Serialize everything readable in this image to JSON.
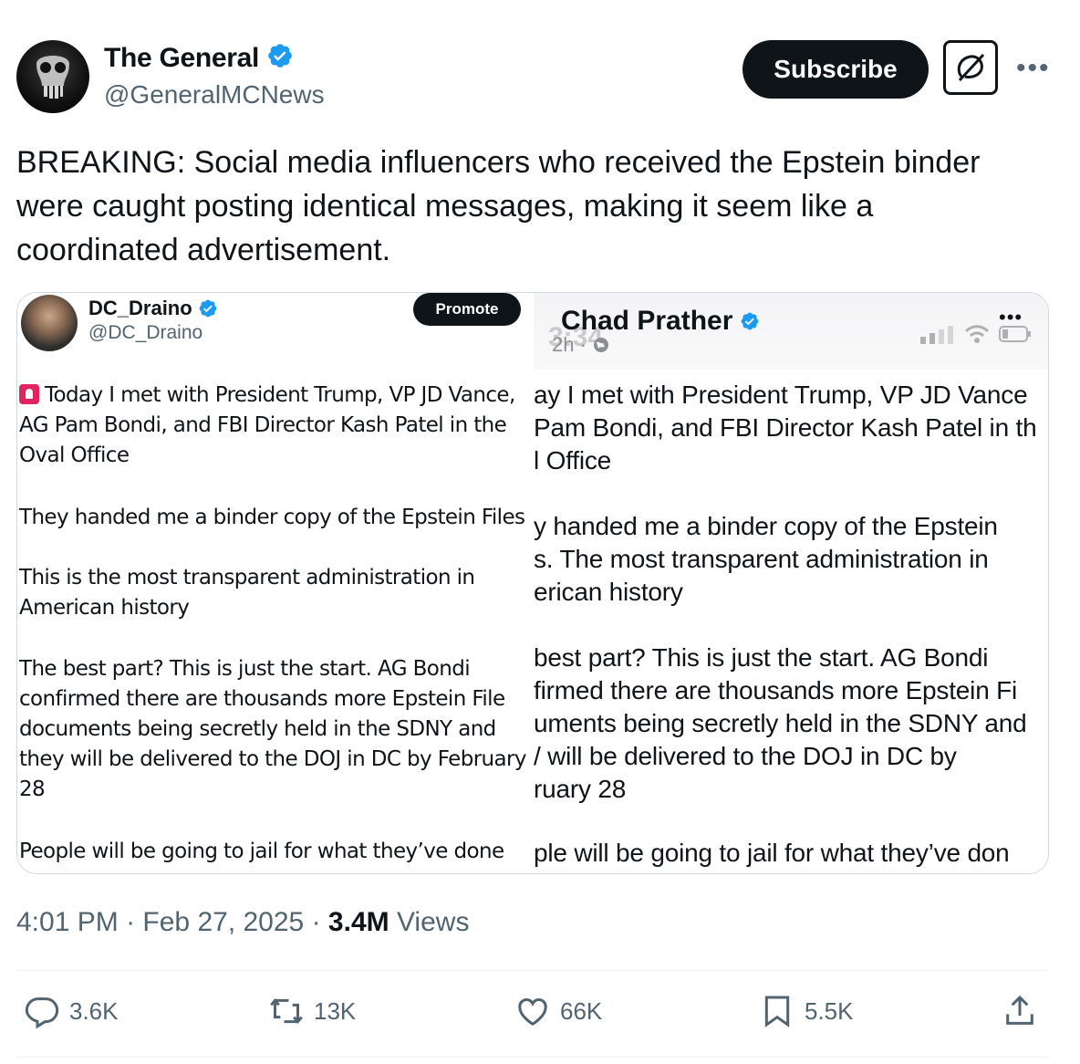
{
  "author": {
    "name": "The General",
    "handle": "@GeneralMCNews",
    "verified": true
  },
  "header_buttons": {
    "subscribe_label": "Subscribe",
    "grok_icon": "grok-icon",
    "more_icon": "more-icon"
  },
  "tweet": {
    "text": "BREAKING: Social media influencers who received the Epstein binder were caught posting identical messages, making it seem like a coordinated advertisement."
  },
  "media": {
    "left": {
      "name": "DC_Draino",
      "handle": "@DC_Draino",
      "promote_label": "Promote",
      "paragraphs": [
        "Today I met with President Trump, VP JD Vance, AG Pam Bondi, and FBI Director Kash Patel in the Oval Office",
        "They handed me a binder copy of the Epstein Files",
        "This is the most transparent administration in American history",
        "The best part? This is just the start. AG Bondi confirmed there are thousands more Epstein File documents being secretly held in the SDNY and they will be delivered to the DOJ in DC by February 28",
        "People will be going to jail for what they’ve done"
      ]
    },
    "right": {
      "name": "Chad Prather",
      "time_ago": "2h ·",
      "ghost_time": "3:34",
      "lines": [
        "ay I met with President Trump, VP JD Vance",
        "Pam Bondi, and FBI Director Kash Patel in th",
        "l Office",
        "y handed me a binder copy of the Epstein",
        "s. The most transparent administration in",
        "erican history",
        " best part? This is just the start. AG Bondi",
        "firmed there are thousands more Epstein Fi",
        "uments being secretly held in the SDNY and",
        "/ will be delivered to the DOJ in DC by",
        "ruary 28",
        "ple will be going to jail for what they’ve don"
      ]
    }
  },
  "meta": {
    "time": "4:01 PM",
    "sep": "·",
    "date": "Feb 27, 2025",
    "views_count": "3.4M",
    "views_label": "Views"
  },
  "actions": {
    "replies": "3.6K",
    "reposts": "13K",
    "likes": "66K",
    "bookmarks": "5.5K"
  },
  "colors": {
    "verified": "#1d9bf0",
    "text": "#0f1419",
    "secondary": "#536471"
  }
}
